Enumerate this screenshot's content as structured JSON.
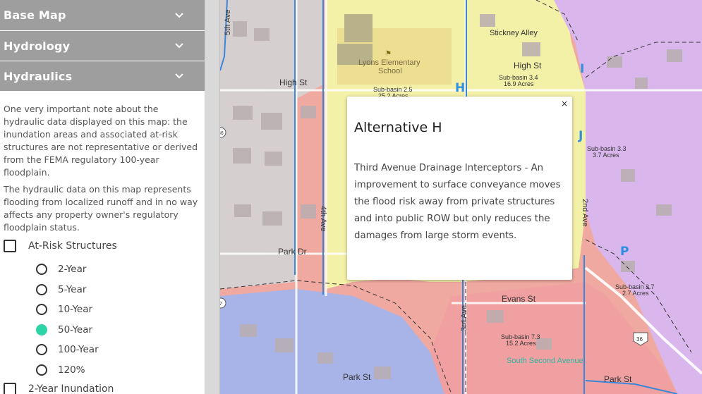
{
  "sidebar": {
    "panels": [
      {
        "label": "Base Map"
      },
      {
        "label": "Hydrology"
      },
      {
        "label": "Hydraulics"
      }
    ],
    "notes": [
      "One very important note about the hydraulic data displayed on this map: the inundation areas and associated at-risk structures are not representative or derived from the FEMA regulatory 100-year floodplain.",
      "The hydraulic data on this map represents flooding from localized runoff and in no way affects any property owner's regulatory floodplain status."
    ],
    "at_risk": {
      "label": "At-Risk Structures",
      "checked": false,
      "options": [
        {
          "label": "2-Year",
          "selected": false
        },
        {
          "label": "5-Year",
          "selected": false
        },
        {
          "label": "10-Year",
          "selected": false
        },
        {
          "label": "50-Year",
          "selected": true
        },
        {
          "label": "100-Year",
          "selected": false
        },
        {
          "label": "120%",
          "selected": false
        }
      ]
    },
    "inundation": {
      "label": "2-Year Inundation",
      "checked": false
    }
  },
  "map": {
    "streets": [
      "5th Ave",
      "High St",
      "High St",
      "Stickney Alley",
      "Park Dr",
      "4th Ave",
      "2nd Ave",
      "3rd Ave",
      "Evans St",
      "Park St",
      "Park St",
      "South Second Avenue"
    ],
    "school": [
      "Lyons Elementary",
      "School"
    ],
    "subbasins": [
      {
        "name": "Sub-basin 2.5",
        "area": "25.2 Acres"
      },
      {
        "name": "Sub-basin 3.4",
        "area": "16.9 Acres"
      },
      {
        "name": "Sub-basin 3.3",
        "area": "3.7 Acres"
      },
      {
        "name": "Sub-basin 3.7",
        "area": "2.7 Acres"
      },
      {
        "name": "Sub-basin 7.3",
        "area": "15.2 Acres"
      }
    ],
    "markers": [
      "H",
      "I",
      "J",
      "P"
    ],
    "shields": [
      "36",
      "7",
      "36"
    ],
    "colors": {
      "high_risk": "#f0a9a0",
      "moderate_risk": "#f3f0a8",
      "basin_purple": "#d9b6ec",
      "basin_blue": "#a8b4e8",
      "basin_gray": "#d6cfd0",
      "channel": "#3a86d8",
      "marker": "#2f8fe0",
      "highlight_text": "#2db6a4"
    }
  },
  "popup": {
    "close": "×",
    "title": "Alternative H",
    "body": "Third Avenue Drainage Interceptors - An improvement to surface conveyance moves the flood risk away from private structures and into public ROW but only reduces the damages from large storm events."
  }
}
